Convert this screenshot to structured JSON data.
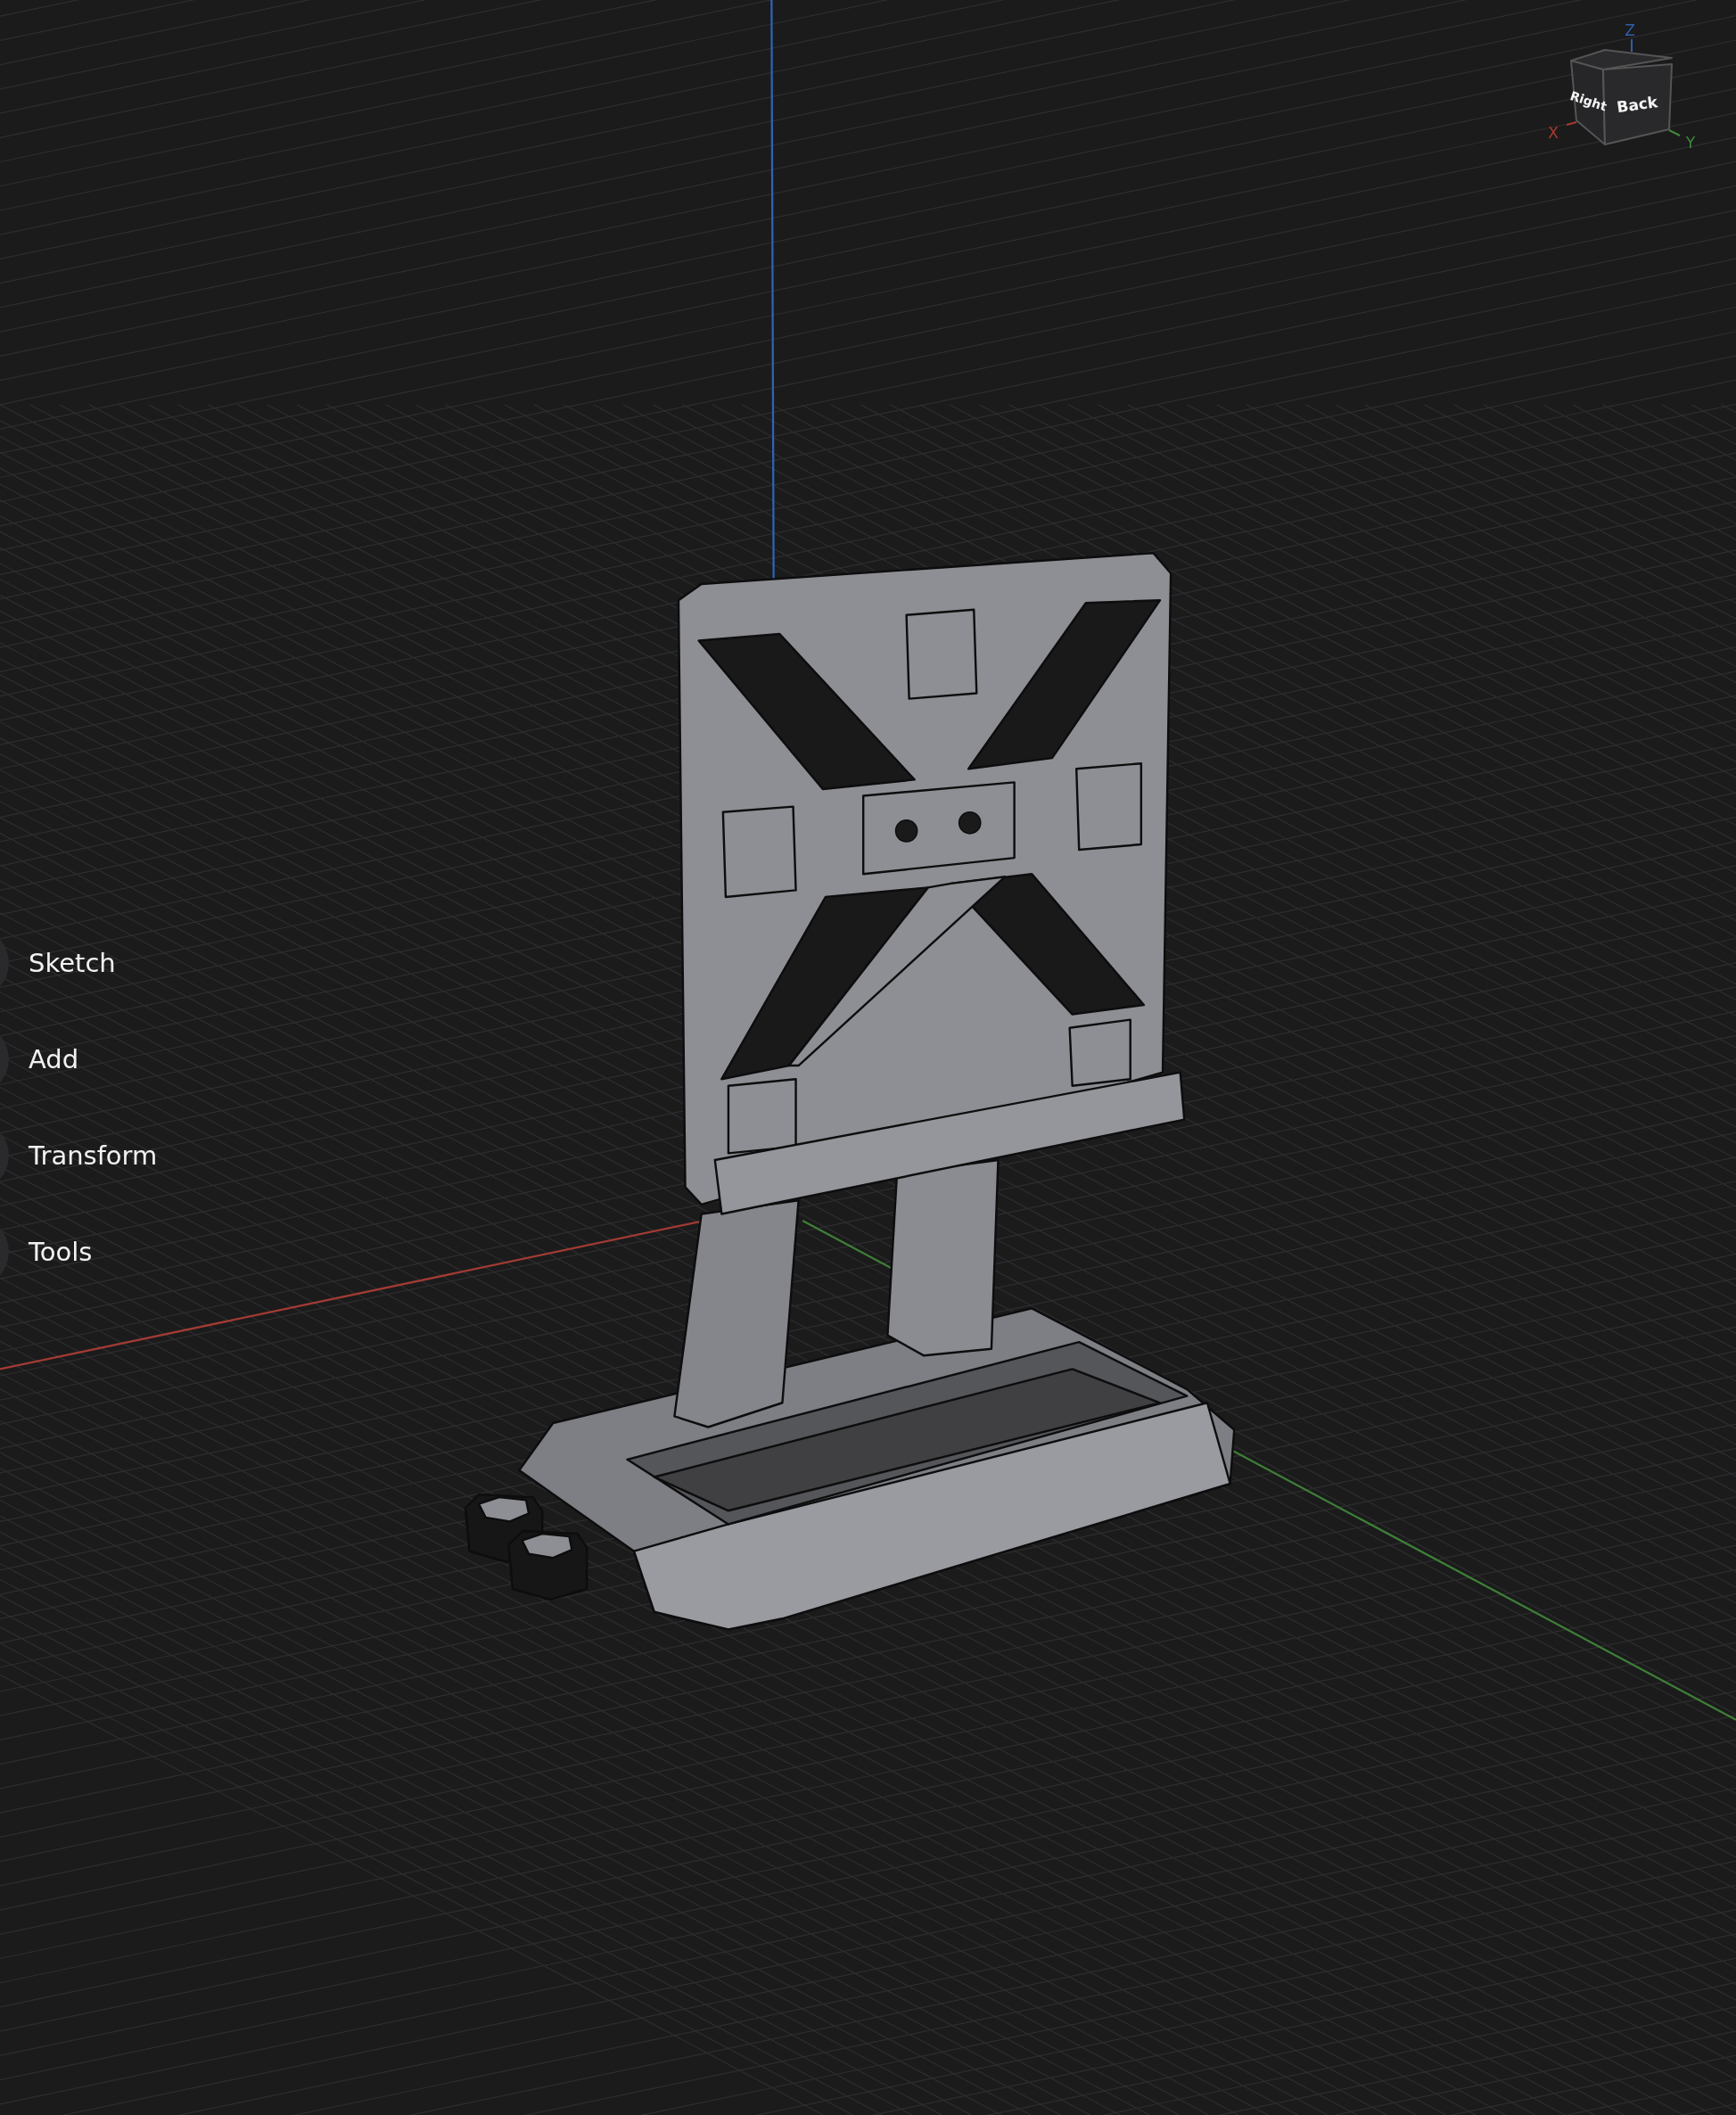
{
  "menu": {
    "items": [
      {
        "label": "Sketch"
      },
      {
        "label": "Add"
      },
      {
        "label": "Transform"
      },
      {
        "label": "Tools"
      }
    ]
  },
  "view_cube": {
    "faces": [
      {
        "label": "Right",
        "kind": "side"
      },
      {
        "label": "Back",
        "kind": "front"
      }
    ],
    "axes": [
      {
        "label": "Z",
        "color": "#2f5fa8"
      },
      {
        "label": "X",
        "color": "#a8392f"
      },
      {
        "label": "Y",
        "color": "#3f8a3a"
      }
    ]
  }
}
